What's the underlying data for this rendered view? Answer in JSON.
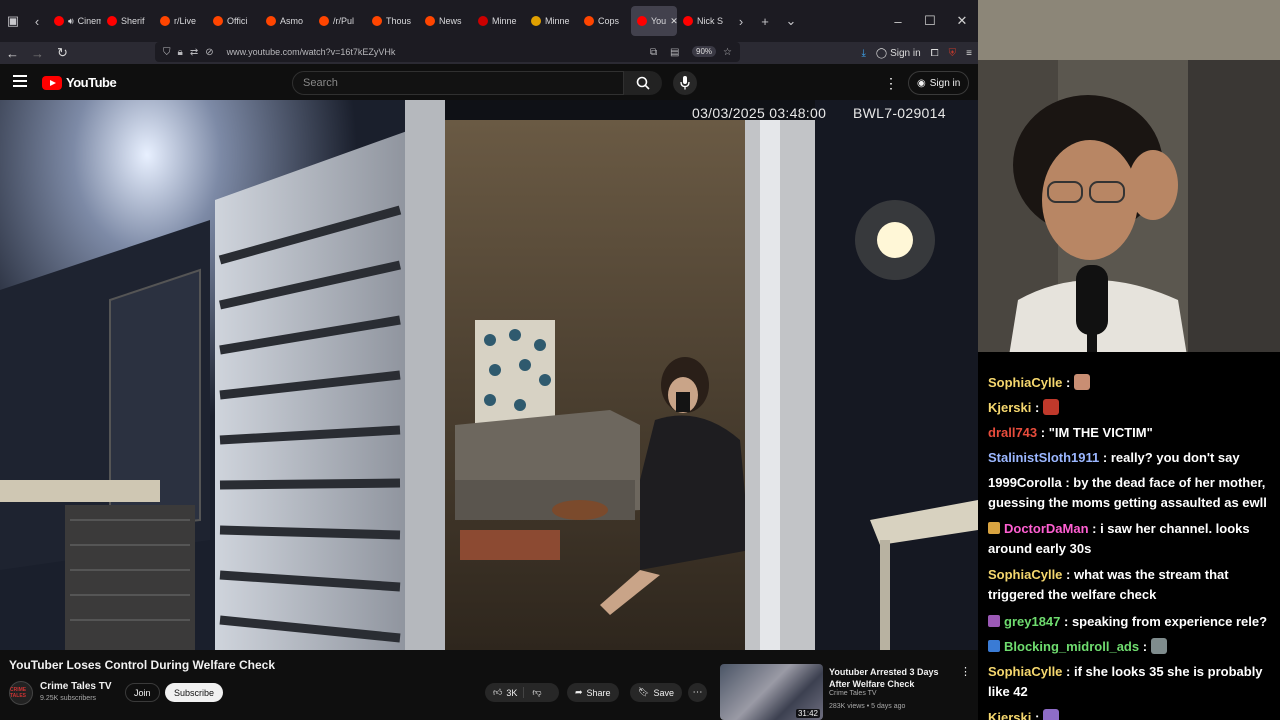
{
  "browser": {
    "tabs": [
      {
        "label": "Cinem",
        "color": "#ff0000"
      },
      {
        "label": "Sherif",
        "color": "#ff0000"
      },
      {
        "label": "r/Live",
        "color": "#ff4500"
      },
      {
        "label": "Offici",
        "color": "#ff4500"
      },
      {
        "label": "Asmo",
        "color": "#ff4500"
      },
      {
        "label": "/r/Pul",
        "color": "#ff4500"
      },
      {
        "label": "Thous",
        "color": "#ff4500"
      },
      {
        "label": "News",
        "color": "#ff4500"
      },
      {
        "label": "Minne",
        "color": "#cc0000"
      },
      {
        "label": "Minne",
        "color": "#e0a000"
      },
      {
        "label": "Cops",
        "color": "#ff4500"
      },
      {
        "label": "You",
        "color": "#ff0000"
      },
      {
        "label": "Nick S",
        "color": "#ff0000"
      }
    ],
    "url": "www.youtube.com/watch?v=16t7kEZyVHk",
    "zoom": "90%",
    "signin": "Sign in"
  },
  "youtube": {
    "logo": "YouTube",
    "search_placeholder": "Search",
    "signin": "Sign in",
    "osd_datetime": "03/03/2025 03:48:00",
    "osd_device": "BWL7-029014",
    "video_title": "YouTuber Loses Control During Welfare Check",
    "channel_name": "Crime Tales TV",
    "channel_subs": "9.25K subscribers",
    "channel_avatar_text": "CRIME TALES",
    "join": "Join",
    "subscribe": "Subscribe",
    "likes": "3K",
    "share": "Share",
    "save": "Save",
    "rec": {
      "title": "Youtuber Arrested 3 Days After Welfare Check",
      "channel": "Crime Tales TV",
      "meta": "283K views • 5 days ago",
      "duration": "31:42"
    }
  },
  "chat": [
    {
      "user": "SophiaCylle",
      "color": "#f5d76e",
      "text": " : ",
      "emote": "#c98e73",
      "badge": null
    },
    {
      "user": "Kjerski",
      "color": "#f5d76e",
      "text": " : ",
      "emote": "#c0392b",
      "badge": null
    },
    {
      "user": "drall743",
      "color": "#e74c3c",
      "text": " : \"IM THE VICTIM\"",
      "emote": null,
      "badge": null
    },
    {
      "user": "StalinistSloth1911",
      "color": "#9bb7ff",
      "text": " : really? you don't say",
      "emote": null,
      "badge": null
    },
    {
      "user": "1999Corolla",
      "color": "#ffffff",
      "text": " : by the dead face of her mother, guessing the moms getting assaulted as ewll",
      "emote": null,
      "badge": null
    },
    {
      "user": "DoctorDaMan",
      "color": "#ff5fd2",
      "text": " : i saw her channel. looks around early 30s",
      "emote": null,
      "badge": "#d9a441"
    },
    {
      "user": "SophiaCylle",
      "color": "#f5d76e",
      "text": " : what was the stream that triggered the welfare check",
      "emote": null,
      "badge": null
    },
    {
      "user": "grey1847",
      "color": "#6fdc6f",
      "text": " : speaking from experience rele?",
      "emote": null,
      "badge": "#9b59b6"
    },
    {
      "user": "Blocking_midroll_ads",
      "color": "#6fdc6f",
      "text": " : ",
      "emote": "#7f8c8d",
      "badge": "#3a7bd5"
    },
    {
      "user": "SophiaCylle",
      "color": "#f5d76e",
      "text": " : if she looks 35 she is probably like 42",
      "emote": null,
      "badge": null
    },
    {
      "user": "Kjerski",
      "color": "#f5d76e",
      "text": " : ",
      "emote": "#8e6cc7",
      "badge": null
    }
  ]
}
